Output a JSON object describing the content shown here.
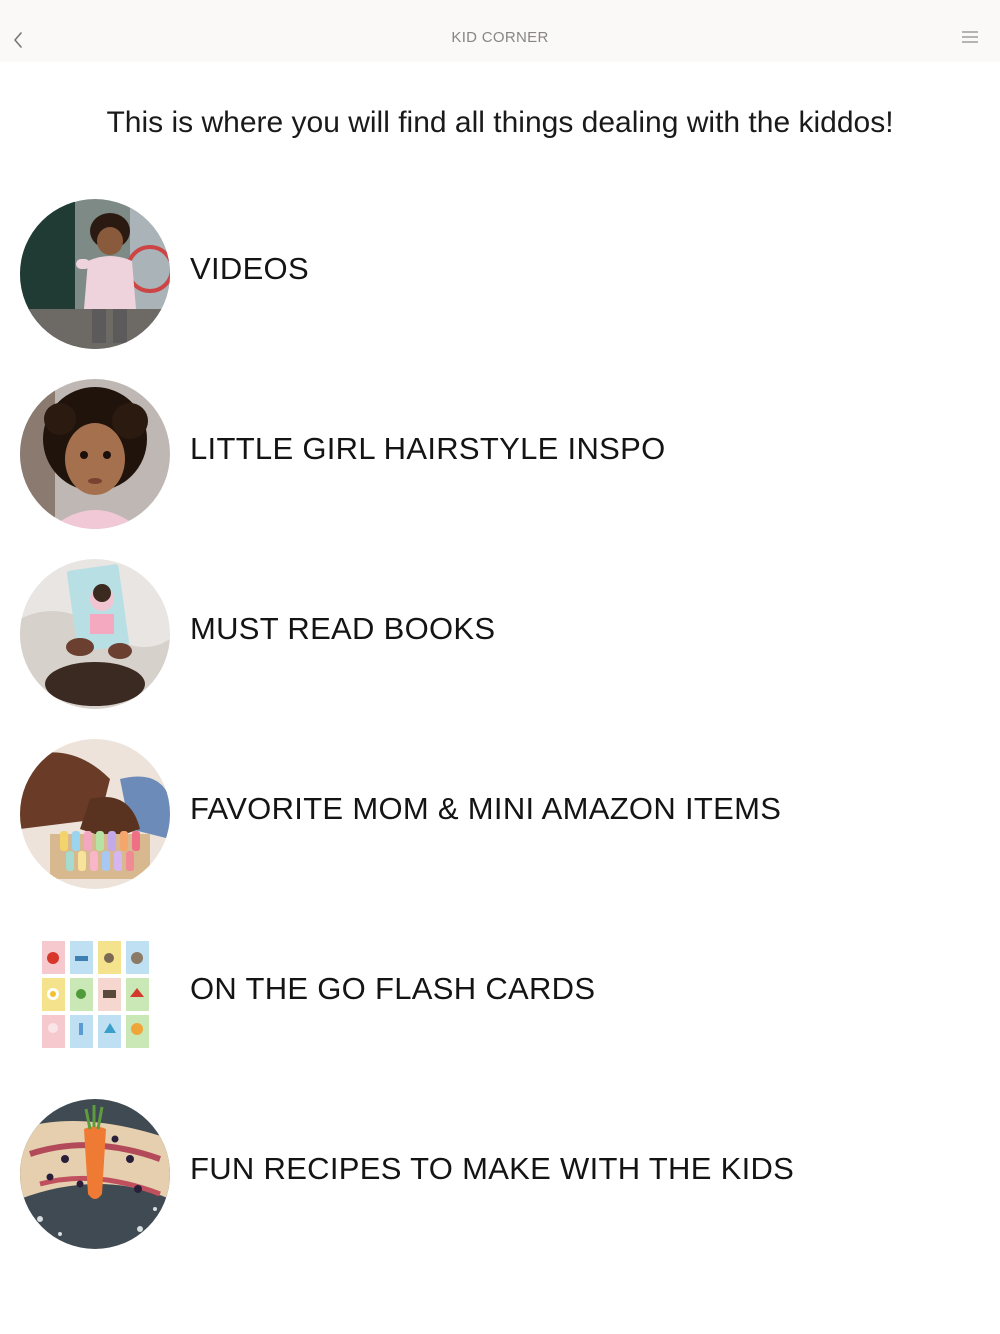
{
  "nav": {
    "title": "KID CORNER",
    "back_icon": "chevron-left-icon",
    "menu_icon": "hamburger-menu-icon"
  },
  "intro": "This is where you will find all things dealing with the kiddos!",
  "items": [
    {
      "label": "VIDEOS",
      "thumb": "toddler-in-pink-coat-photo"
    },
    {
      "label": "LITTLE GIRL HAIRSTYLE INSPO",
      "thumb": "curly-haired-girl-portrait-photo"
    },
    {
      "label": "MUST READ BOOKS",
      "thumb": "child-reading-book-photo"
    },
    {
      "label": "FAVORITE MOM & MINI AMAZON ITEMS",
      "thumb": "hands-with-chalk-photo"
    },
    {
      "label": "ON THE GO FLASH CARDS",
      "thumb": "alphabet-flash-cards-image"
    },
    {
      "label": "FUN RECIPES TO MAKE WITH THE KIDS",
      "thumb": "carrot-snack-plate-photo"
    }
  ],
  "colors": {
    "navbar_bg": "#fbf8f8",
    "nav_title": "#8a8585",
    "text": "#141414"
  }
}
